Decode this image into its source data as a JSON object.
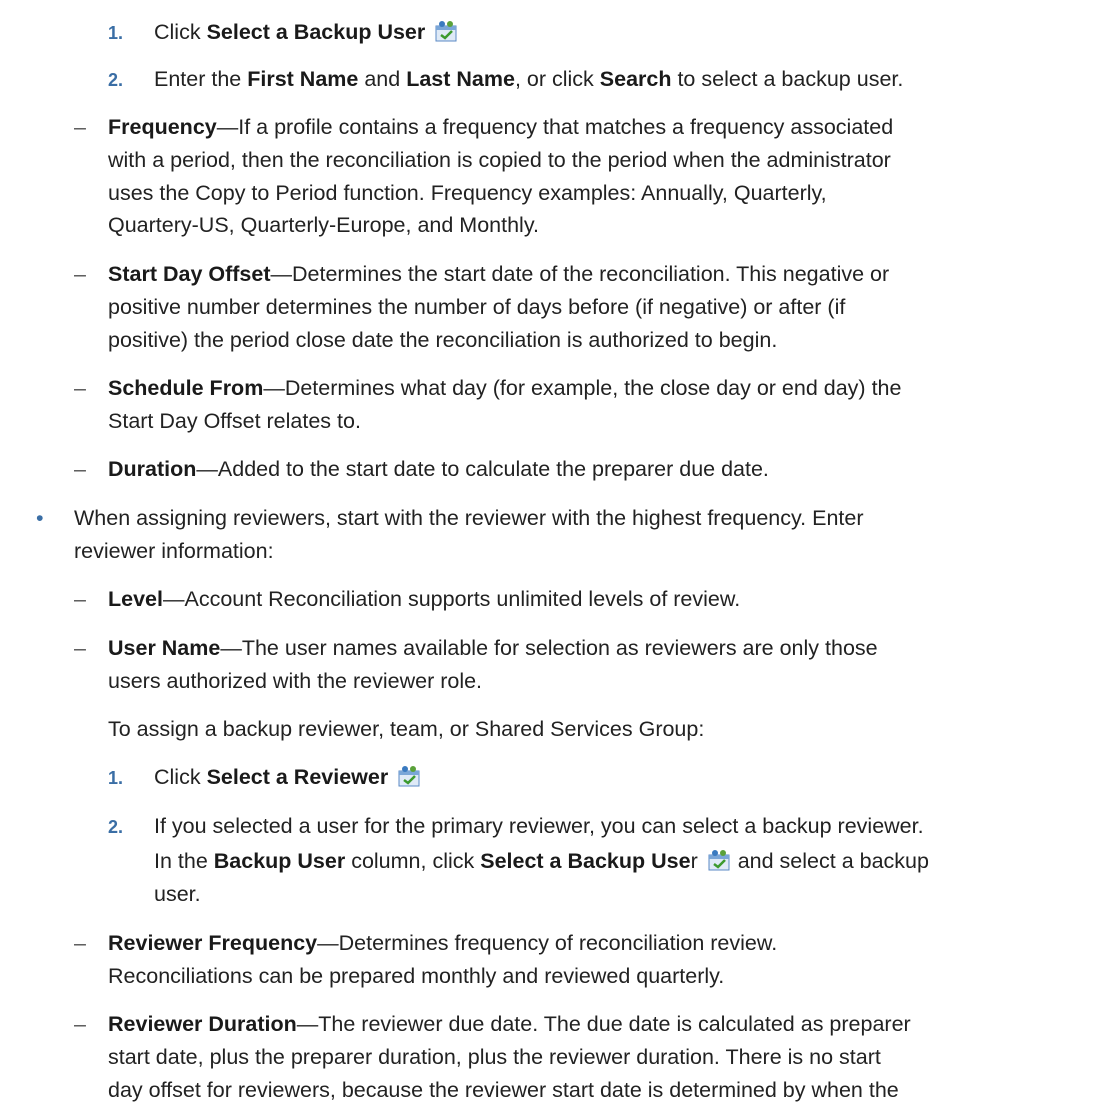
{
  "backup_user_steps": [
    {
      "number": "1.",
      "lead": "Click ",
      "bold": "Select a Backup User"
    },
    {
      "number": "2.",
      "lead": "Enter the ",
      "bold1": "First Name",
      "mid1": " and ",
      "bold2": "Last Name",
      "mid2": ", or click ",
      "bold3": "Search",
      "tail": " to select a backup user."
    }
  ],
  "preparer_fields": {
    "frequency": {
      "marker": "–",
      "term": "Frequency",
      "lines": [
        "—If a profile contains a frequency that matches a frequency associated",
        "with a period, then the reconciliation is copied to the period when the administrator",
        "uses the Copy to Period function. Frequency examples: Annually, Quarterly,",
        "Quartery-US, Quarterly-Europe, and Monthly."
      ]
    },
    "start_day_offset": {
      "marker": "–",
      "term": "Start Day Offset",
      "lines": [
        "—Determines the start date of the reconciliation. This negative or",
        "positive number determines the number of days before (if negative) or after (if",
        "positive) the period close date the reconciliation is authorized to begin."
      ]
    },
    "schedule_from": {
      "marker": "–",
      "term": "Schedule From",
      "lines": [
        "—Determines what day (for example, the close day or end day) the",
        "Start Day Offset relates to."
      ]
    },
    "duration": {
      "marker": "–",
      "term": "Duration",
      "lines": [
        "—Added to the start date to calculate the preparer due date."
      ]
    }
  },
  "reviewers_bullet": {
    "marker": "•",
    "lines": [
      "When assigning reviewers, start with the reviewer with the highest frequency. Enter",
      "reviewer information:"
    ]
  },
  "reviewer_fields": {
    "level": {
      "marker": "–",
      "term": "Level",
      "lines": [
        "—Account Reconciliation supports unlimited levels of review."
      ]
    },
    "user_name": {
      "marker": "–",
      "term": "User Name",
      "lines": [
        "—The user names available for selection as reviewers are only those",
        "users authorized with the reviewer role."
      ]
    },
    "assign_intro": "To assign a backup reviewer, team, or Shared Services Group:",
    "steps": [
      {
        "number": "1.",
        "lead": "Click ",
        "bold": "Select a Reviewer"
      },
      {
        "number": "2.",
        "line1": "If you selected a user for the primary reviewer, you can select a backup reviewer.",
        "line2_lead": "In the ",
        "line2_bold1": "Backup User",
        "line2_mid": " column, click ",
        "line2_bold2": "Select a Backup Use",
        "line2_after": "r",
        "line2_tail": " and select a backup",
        "line3": "user."
      }
    ],
    "reviewer_frequency": {
      "marker": "–",
      "term": "Reviewer Frequency",
      "lines": [
        "—Determines frequency of reconciliation review.",
        "Reconciliations can be prepared monthly and reviewed quarterly."
      ]
    },
    "reviewer_duration": {
      "marker": "–",
      "term": "Reviewer Duration",
      "lines": [
        "—The reviewer due date. The due date is calculated as preparer",
        "start date, plus the preparer duration, plus the reviewer duration. There is no start",
        "day offset for reviewers, because the reviewer start date is determined by when the"
      ]
    }
  },
  "icons": {
    "select_user": "select-user-icon"
  }
}
